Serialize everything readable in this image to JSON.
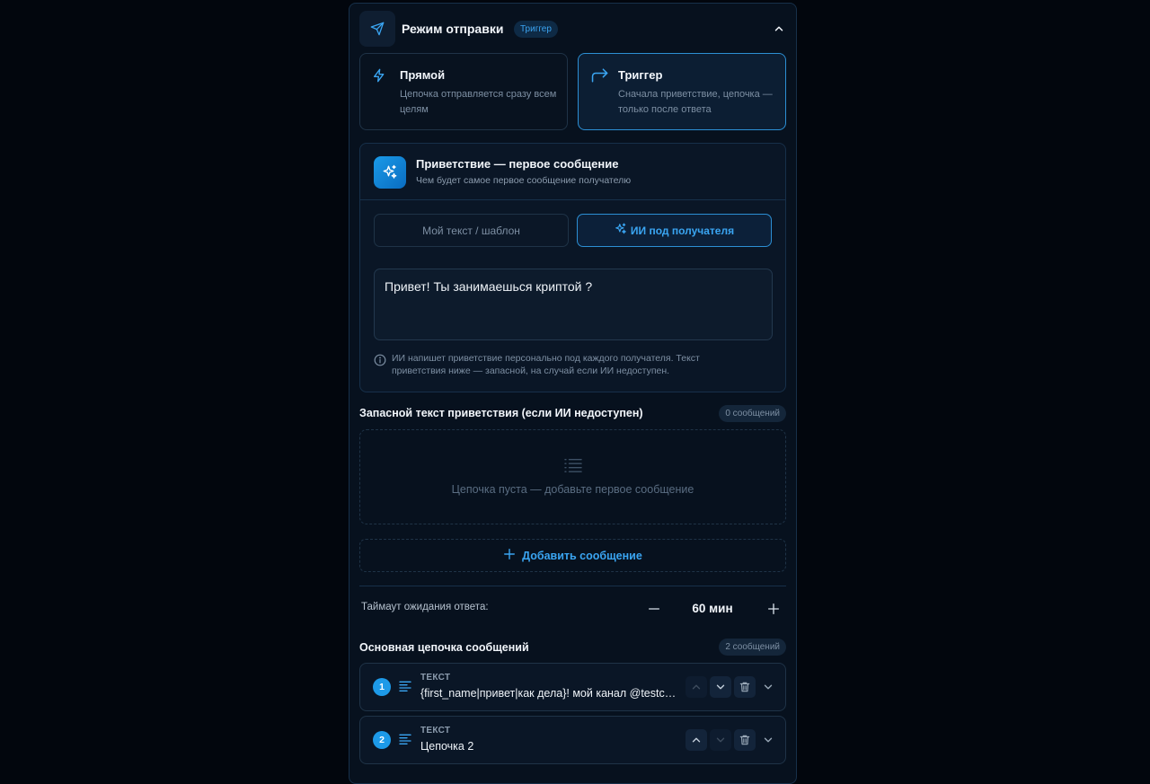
{
  "header": {
    "title": "Режим отправки",
    "badge": "Триггер"
  },
  "modes": [
    {
      "title": "Прямой",
      "desc": "Цепочка отправляется сразу всем целям"
    },
    {
      "title": "Триггер",
      "desc": "Сначала приветствие, цепочка — только после ответа"
    }
  ],
  "greeting": {
    "title": "Приветствие — первое сообщение",
    "subtitle": "Чем будет самое первое сообщение получателю",
    "tab_custom": "Мой текст / шаблон",
    "tab_ai": "ИИ под получателя",
    "text": "Привет! Ты занимаешься криптой ?",
    "note": "ИИ напишет приветствие персонально под каждого получателя. Текст приветствия ниже — запасной, на случай если ИИ недоступен."
  },
  "fallback": {
    "title": "Запасной текст приветствия (если ИИ недоступен)",
    "count": "0 сообщений",
    "empty": "Цепочка пуста — добавьте первое сообщение",
    "add_label": "Добавить сообщение"
  },
  "timeout": {
    "label": "Таймаут ожидания ответа:",
    "value": "60 мин"
  },
  "chain": {
    "title": "Основная цепочка сообщений",
    "count": "2 сообщений",
    "items": [
      {
        "num": "1",
        "type": "ТЕКСТ",
        "text": "{first_name|привет|как дела}! мой канал @testchannel"
      },
      {
        "num": "2",
        "type": "ТЕКСТ",
        "text": "Цепочка 2"
      }
    ]
  }
}
